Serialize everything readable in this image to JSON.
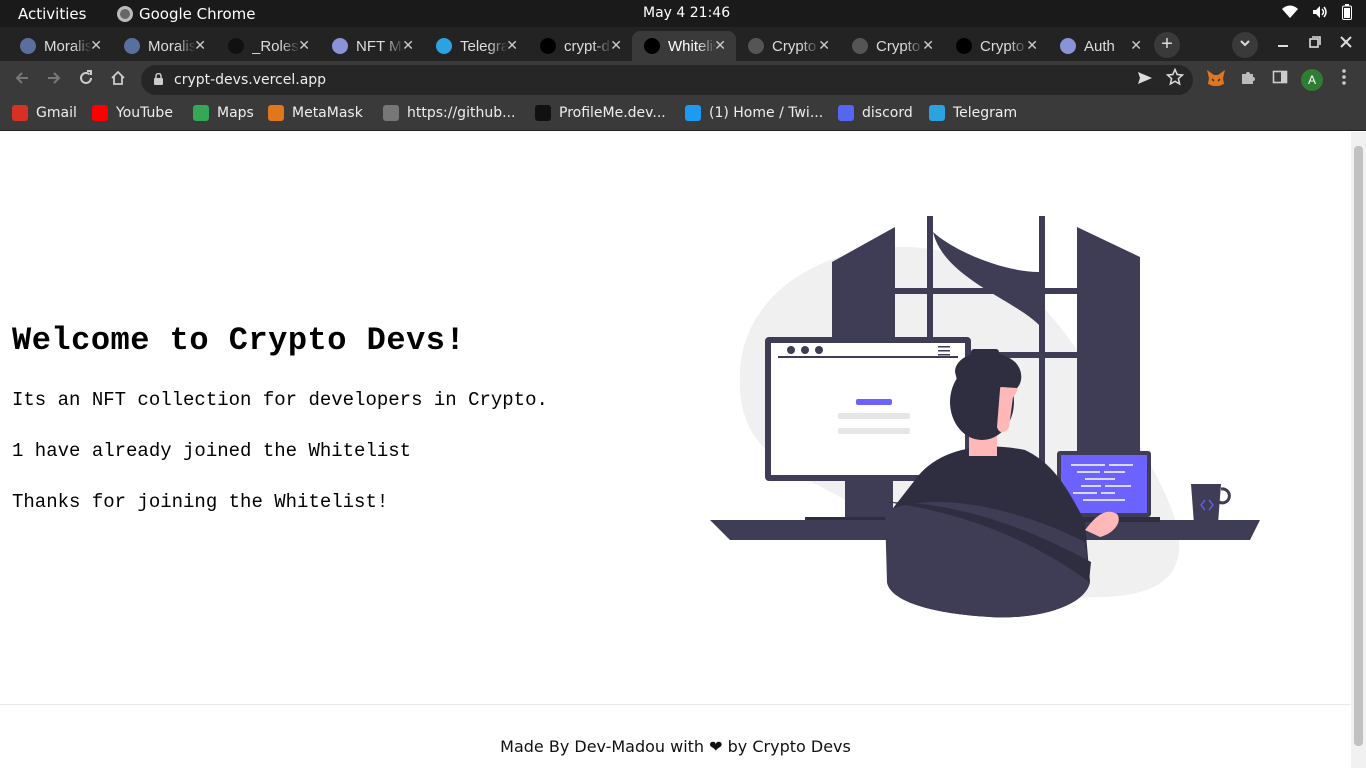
{
  "system_bar": {
    "activities": "Activities",
    "app_name": "Google Chrome",
    "clock": "May 4  21:46"
  },
  "tabs": [
    {
      "title": "Moralis",
      "icon": "moralis-icon",
      "color": "#5a6f9e"
    },
    {
      "title": "Moralis",
      "icon": "moralis-icon",
      "color": "#5a6f9e"
    },
    {
      "title": "_Roles",
      "icon": "m-logo-icon",
      "color": "#111111"
    },
    {
      "title": "NFT Marketplace",
      "icon": "ethereum-icon",
      "color": "#8a92d8"
    },
    {
      "title": "Telegram",
      "icon": "telegram-icon",
      "color": "#2aa3e0"
    },
    {
      "title": "crypt-devs",
      "icon": "vercel-icon",
      "color": "#000000"
    },
    {
      "title": "Whitelist Dapp",
      "icon": "vercel-icon",
      "color": "#000000",
      "active": true
    },
    {
      "title": "Crypto Devs",
      "icon": "blank-icon",
      "color": "#555555"
    },
    {
      "title": "Crypto Devs",
      "icon": "blank-icon",
      "color": "#555555"
    },
    {
      "title": "Crypto Devs",
      "icon": "vercel-icon",
      "color": "#000000"
    },
    {
      "title": "Auth",
      "icon": "ethereum-icon",
      "color": "#8a92d8"
    }
  ],
  "omnibox": {
    "url": "crypt-devs.vercel.app"
  },
  "profile_initial": "A",
  "bookmarks": [
    {
      "label": "Gmail",
      "icon": "gmail-icon",
      "color": "#d93025"
    },
    {
      "label": "YouTube",
      "icon": "youtube-icon",
      "color": "#ff0000"
    },
    {
      "label": "Maps",
      "icon": "maps-icon",
      "color": "#34a853"
    },
    {
      "label": "MetaMask",
      "icon": "metamask-icon",
      "color": "#e2761b"
    },
    {
      "label": "https://github...",
      "icon": "globe-icon",
      "color": "#777777"
    },
    {
      "label": "ProfileMe.dev...",
      "icon": "profileme-icon",
      "color": "#111111"
    },
    {
      "label": "(1) Home / Twi...",
      "icon": "twitter-icon",
      "color": "#1d9bf0"
    },
    {
      "label": "discord",
      "icon": "discord-icon",
      "color": "#5865f2"
    },
    {
      "label": "Telegram",
      "icon": "telegram-icon",
      "color": "#2aa3e0"
    }
  ],
  "page": {
    "title": "Welcome to Crypto Devs!",
    "description": "Its an NFT collection for developers in Crypto.",
    "joined": "1 have already joined the Whitelist",
    "thanks": "Thanks for joining the Whitelist!",
    "footer": "Made By Dev-Madou with ❤ by Crypto Devs"
  },
  "colors": {
    "accent": "#6c63ff",
    "dark": "#3f3d56"
  }
}
